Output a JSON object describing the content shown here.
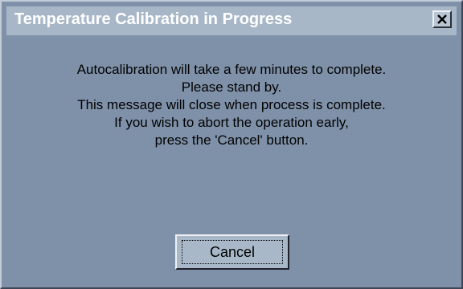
{
  "dialog": {
    "title": "Temperature Calibration in Progress",
    "close_icon": "close-icon",
    "message_lines": [
      "Autocalibration  will take a few minutes to complete.",
      "Please stand by.",
      "This message will close when process is complete.",
      "If you wish to abort the operation early,",
      "press the 'Cancel' button."
    ],
    "cancel_label": "Cancel"
  },
  "colors": {
    "window_background": "#7f91a8",
    "titlebar_background": "#a8b7c8",
    "button_face": "#a9b8c9",
    "title_text": "#ffffff",
    "body_text": "#000000"
  }
}
